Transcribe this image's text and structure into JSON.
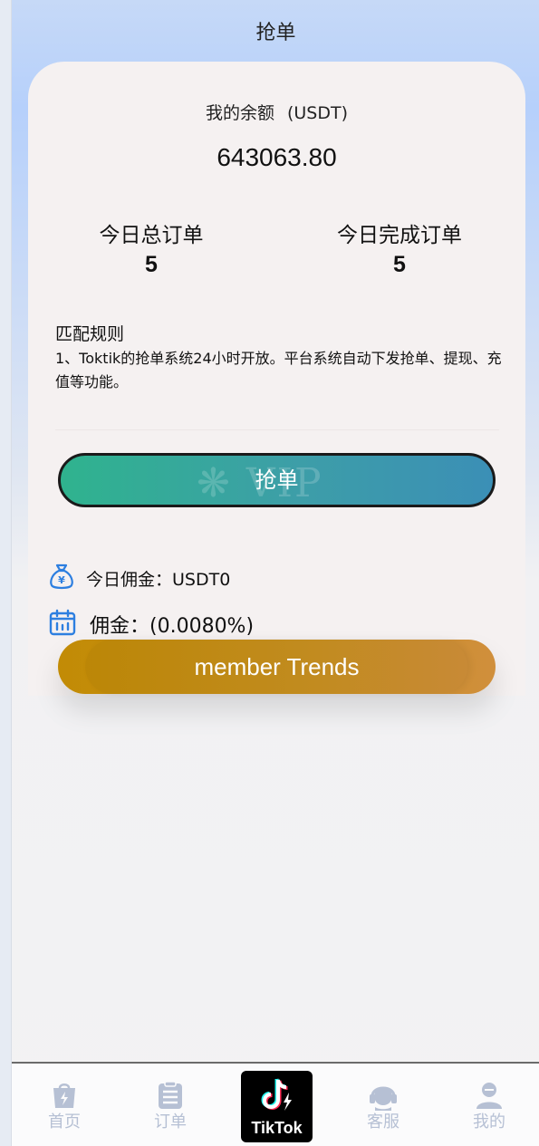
{
  "header": {
    "title": "抢单"
  },
  "balance": {
    "label": "我的余额",
    "unit": "(USDT)",
    "value": "643063.80"
  },
  "stats": {
    "today_total_label": "今日总订单",
    "today_total_value": "5",
    "today_done_label": "今日完成订单",
    "today_done_value": "5"
  },
  "rules": {
    "title": "匹配规则",
    "text": "1、Toktik的抢单系统24小时开放。平台系统自动下发抢单、提现、充值等功能。"
  },
  "grab_button": {
    "label": "抢单"
  },
  "info": {
    "today_commission": "今日佣金：USDT0",
    "commission_rate": "佣金：(0.0080%)"
  },
  "trends_button": {
    "label": "member Trends"
  },
  "tabbar": {
    "items": [
      {
        "label": "首页",
        "icon": "home-bag-icon"
      },
      {
        "label": "订单",
        "icon": "clipboard-icon"
      },
      {
        "label": "TikTok",
        "icon": "tiktok-logo"
      },
      {
        "label": "客服",
        "icon": "headset-icon"
      },
      {
        "label": "我的",
        "icon": "user-icon"
      }
    ]
  },
  "colors": {
    "accent_blue": "#2d7fe0",
    "grab_gradient_start": "#2fb38e",
    "grab_gradient_end": "#3b8fb6",
    "trends_gradient_start": "#c28b05",
    "trends_gradient_end": "#d08f3c",
    "tab_inactive": "#b6c0d4"
  }
}
